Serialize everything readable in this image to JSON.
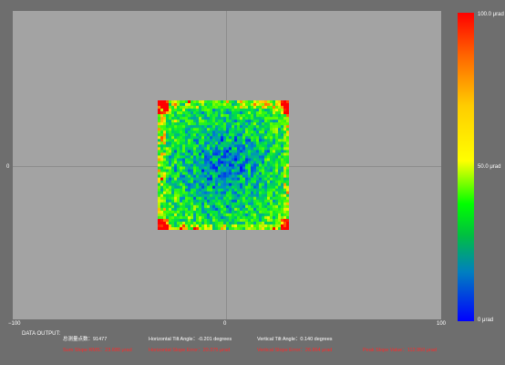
{
  "plot": {
    "axis_labels": {
      "y_zero": "0",
      "x_min": "−100",
      "x_zero": "0",
      "x_max": "100"
    }
  },
  "colorbar": {
    "top_label": "100.0 μrad",
    "mid_label": "50.0 μrad",
    "bottom_label": "0 μrad",
    "colors": [
      "#ff0000",
      "#ffff00",
      "#00ff00",
      "#0000ff"
    ]
  },
  "output": {
    "title": "DATA OUTPUT:",
    "count": "总测量点数：91477",
    "h_tilt": "Horizontal Tilt Angle：-0.201 degrees",
    "v_tilt": "Vertical Tilt Angle：0.140 degrees",
    "rms": "Sum Slope RMS：23.680 μrad",
    "h_error": "Horizontal Slope Error：20.375 μrad",
    "v_error": "Vertical Slope Error：26.864 μrad",
    "peak": "Peak Slope Value：112.950 μrad"
  }
}
